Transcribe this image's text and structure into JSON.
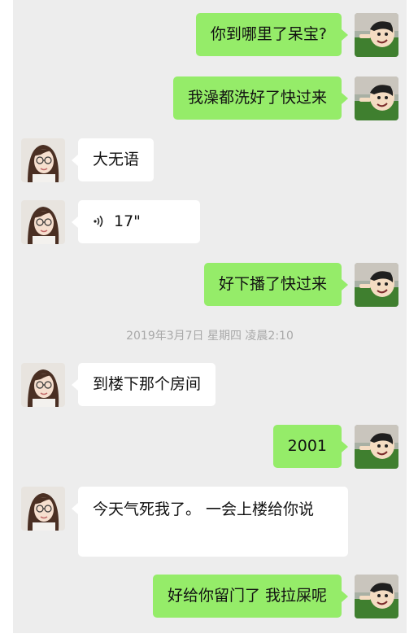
{
  "messages": [
    {
      "sender": "me",
      "text": "你到哪里了呆宝?"
    },
    {
      "sender": "me",
      "text": "我澡都洗好了快过来"
    },
    {
      "sender": "other",
      "text": "大无语"
    },
    {
      "sender": "other",
      "type": "voice",
      "text": "17\"",
      "icon": "voice-wave-icon"
    },
    {
      "sender": "me",
      "text": "好下播了快过来"
    },
    {
      "sender": "other",
      "text": "到楼下那个房间"
    },
    {
      "sender": "me",
      "text": "2001"
    },
    {
      "sender": "other",
      "text": "今天气死我了。 一会上楼给你说"
    },
    {
      "sender": "me",
      "text": "好给你留门了 我拉屎呢"
    }
  ],
  "timestamp": "2019年3月7日 星期四 凌晨2:10",
  "colors": {
    "background": "#ededed",
    "my_bubble": "#95ec69",
    "their_bubble": "#ffffff",
    "timestamp_text": "#a8a8a8"
  },
  "icons": {
    "voice": "voice-wave-icon",
    "my_avatar": "cartoon-man-avatar",
    "their_avatar": "girl-with-glasses-avatar"
  }
}
